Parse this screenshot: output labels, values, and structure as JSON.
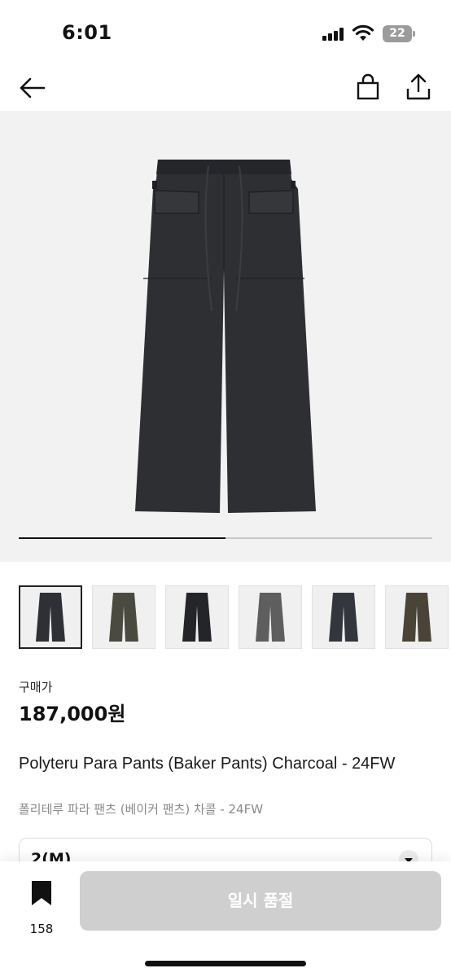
{
  "status_bar": {
    "time": "6:01",
    "battery": "22",
    "icons": [
      "signal-icon",
      "wifi-icon",
      "battery-icon"
    ]
  },
  "nav": {
    "icons": [
      "back-arrow-icon",
      "shopping-bag-icon",
      "share-icon"
    ]
  },
  "hero": {
    "image_subject": "charcoal baker pants",
    "gallery_progress": 0.5
  },
  "thumbnails": [
    {
      "color": "#2f3035",
      "selected": true
    },
    {
      "color": "#4a4a40",
      "selected": false
    },
    {
      "color": "#232529",
      "selected": false
    },
    {
      "color": "#5e5e5e",
      "selected": false
    },
    {
      "color": "#33363d",
      "selected": false
    },
    {
      "color": "#4a4338",
      "selected": false
    }
  ],
  "product": {
    "price_label": "구매가",
    "price": "187,000원",
    "title_en": "Polyteru Para Pants (Baker Pants) Charcoal - 24FW",
    "title_ko": "폴리테루 파라 팬츠 (베이커 팬츠) 차콜 - 24FW"
  },
  "size_select": {
    "value": "2(M)"
  },
  "bottom_bar": {
    "bookmark_count": "158",
    "button_label": "일시 품절"
  },
  "colors": {
    "pants_dark": "#2e2f33",
    "button_disabled": "#cfcfcf",
    "hero_bg": "#f2f2f2"
  }
}
